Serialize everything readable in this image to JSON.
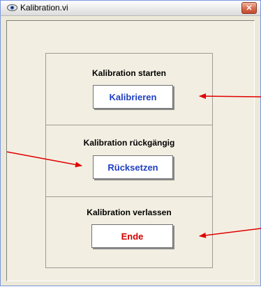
{
  "window": {
    "title": "Kalibration.vi",
    "close_glyph": "✕",
    "icon": "vi-eye-icon"
  },
  "sections": [
    {
      "label": "Kalibration starten",
      "button": "Kalibrieren",
      "color": "#1f3fc0"
    },
    {
      "label": "Kalibration rückgängig",
      "button": "Rücksetzen",
      "color": "#1f3fc0"
    },
    {
      "label": "Kalibration verlassen",
      "button": "Ende",
      "color": "#d10000"
    }
  ],
  "annotations": {
    "arrow_color": "#e00000"
  }
}
